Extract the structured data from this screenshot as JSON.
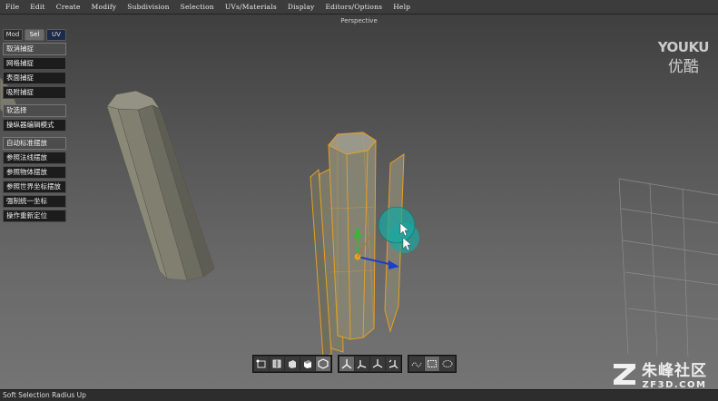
{
  "menubar": {
    "items": [
      "File",
      "Edit",
      "Create",
      "Modify",
      "Subdivision",
      "Selection",
      "UVs/Materials",
      "Display",
      "Editors/Options",
      "Help"
    ]
  },
  "viewport": {
    "label": "Perspective"
  },
  "side_panel": {
    "tabs": [
      "Mod",
      "Sel",
      "UV"
    ],
    "active_tab": "Sel",
    "group1": [
      "取消捕捉",
      "网格捕捉",
      "表面捕捉",
      "吸附捕捉"
    ],
    "group2": [
      "软选择",
      "操纵器编辑模式"
    ],
    "group3": [
      "自动标准摆放",
      "参照法线摆放",
      "参照物体摆放",
      "参照世界坐标摆放",
      "强制统一坐标",
      "操作重新定位"
    ]
  },
  "logos": {
    "youku_en": "YOUKU",
    "youku_cn": "优酷",
    "watermark_cn": "朱峰社区",
    "watermark_url": "ZF3D.COM"
  },
  "toolbar": {
    "group1": [
      "vertex-mode-icon",
      "edge-mode-icon",
      "face-mode-icon",
      "element-mode-icon",
      "object-mode-icon"
    ],
    "group2": [
      "transform-axis-icon",
      "move-axis-icon",
      "rotate-axis-icon",
      "scale-axis-icon"
    ],
    "group3": [
      "curve-icon",
      "rect-select-icon",
      "lasso-select-icon"
    ]
  },
  "status": {
    "text": "Soft Selection Radius Up"
  },
  "colors": {
    "accent": "#e8a020",
    "gizmo_blue": "#1a3fd0",
    "gizmo_green": "#3cb43c",
    "soft_sel": "#1aa7a0"
  }
}
